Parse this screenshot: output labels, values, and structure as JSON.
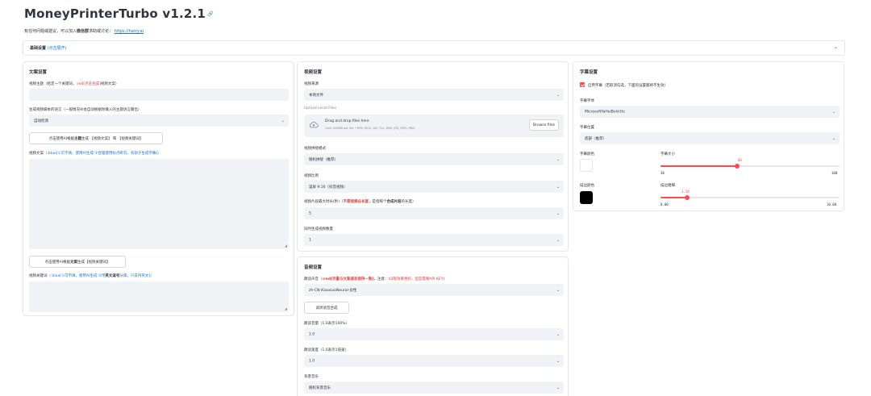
{
  "header": {
    "title": "MoneyPrinterTurbo v1.2.1",
    "subtitle_pre": "有任何问题或建议，可以加入",
    "subtitle_bold": "微信群",
    "subtitle_mid": "求助或讨论：",
    "subtitle_link": "https://harry.ai"
  },
  "basic_settings": {
    "label": "基础设置",
    "hint": "(点击展开)"
  },
  "script_panel": {
    "title": "文案设置",
    "topic_label_pre": "视频主题（给定一个关键词，",
    "topic_label_red": ":red[点击生成]",
    "topic_label_post": "视频文案）",
    "topic_value": "",
    "language_label": "生成视频脚本的语言（一般情况AI会自动根据你输入的主题语言输出）",
    "language_value": "自动检测",
    "gen_button_pre": "点击使用AI根据",
    "gen_button_b1": "主题",
    "gen_button_mid": "生成 【视频文案】 和 【视频关键词】",
    "script_label_pre": "视频文案",
    "script_label_blue": "（:blue[①可不填，使用AI生成 ②合理使用标点断句，有助于生成字幕]）",
    "script_value": "",
    "kw_button_pre": "点击使用AI根据",
    "kw_button_b": "文案",
    "kw_button_post": "生成【视频关键词】",
    "keywords_label_pre": "视频关键词",
    "keywords_label_blue": "（:blue[①可不填，使用AI生成 ②用",
    "keywords_label_bold": "英文逗号",
    "keywords_label_blue2": "分隔，只支持英文]）",
    "keywords_value": ""
  },
  "video_panel": {
    "title": "视频设置",
    "source_label": "视频来源",
    "source_value": "本地文件",
    "upload_label": "Upload Local Files",
    "upload_title": "Drag and drop files here",
    "upload_hint": "Limit 200MB per file • MP4, MOV, AVI, FLV, MKV, JPG, JPEG, PNG",
    "upload_button": "Browse files",
    "concat_label": "视频拼接模式",
    "concat_value": "随机拼接（推荐）",
    "aspect_label": "视频比例",
    "aspect_value": "竖屏 9:16（抖音视频）",
    "clip_label_pre": "视频片段最大时长(秒)（",
    "clip_label_red": "不是视频总长度",
    "clip_label_mid": "，是指每个",
    "clip_label_bold": "合成片段",
    "clip_label_post": "的长度）",
    "clip_value": "5",
    "count_label": "同时生成视频数量",
    "count_value": "1"
  },
  "audio_panel": {
    "title": "音频设置",
    "voice_label_pre": "朗读声音（",
    "voice_label_red": ":red[尽量与文案语言保持一致]",
    "voice_label_mid": "，注意：",
    "voice_label_red2": "V2版效果更好，但是需要API KEY",
    "voice_label_post": "）",
    "voice_value": "zh-CN-XiaoxiaoNeural-女性",
    "try_button": "试听语音合成",
    "volume_label": "朗读音量（1.0表示100%）",
    "volume_value": "1.0",
    "speed_label": "朗读速度（1.0表示1倍速）",
    "speed_value": "1.0",
    "bgm_label": "背景音乐",
    "bgm_value": "随机背景音乐"
  },
  "subtitle_panel": {
    "title": "字幕设置",
    "enable_label": "启用字幕（若取消勾选，下面的设置都将不生效）",
    "font_label": "字幕字体",
    "font_value": "MicrosoftYaHeiBold.ttc",
    "position_label": "字幕位置",
    "position_value": "底部（推荐）",
    "color_label": "字幕颜色",
    "size_label": "字幕大小",
    "size_value": "60",
    "size_min": "30",
    "size_max": "100",
    "size_fraction": 0.43,
    "stroke_color_label": "描边颜色",
    "stroke_width_label": "描边粗细",
    "stroke_value": "1.50",
    "stroke_min": "0.00",
    "stroke_max": "10.00",
    "stroke_fraction": 0.15,
    "font_color": "#ffffff",
    "stroke_color": "#000000"
  },
  "colors": {
    "accent": "#ff4b4b",
    "field_bg": "#f0f2f6",
    "link": "#1a73e8"
  }
}
